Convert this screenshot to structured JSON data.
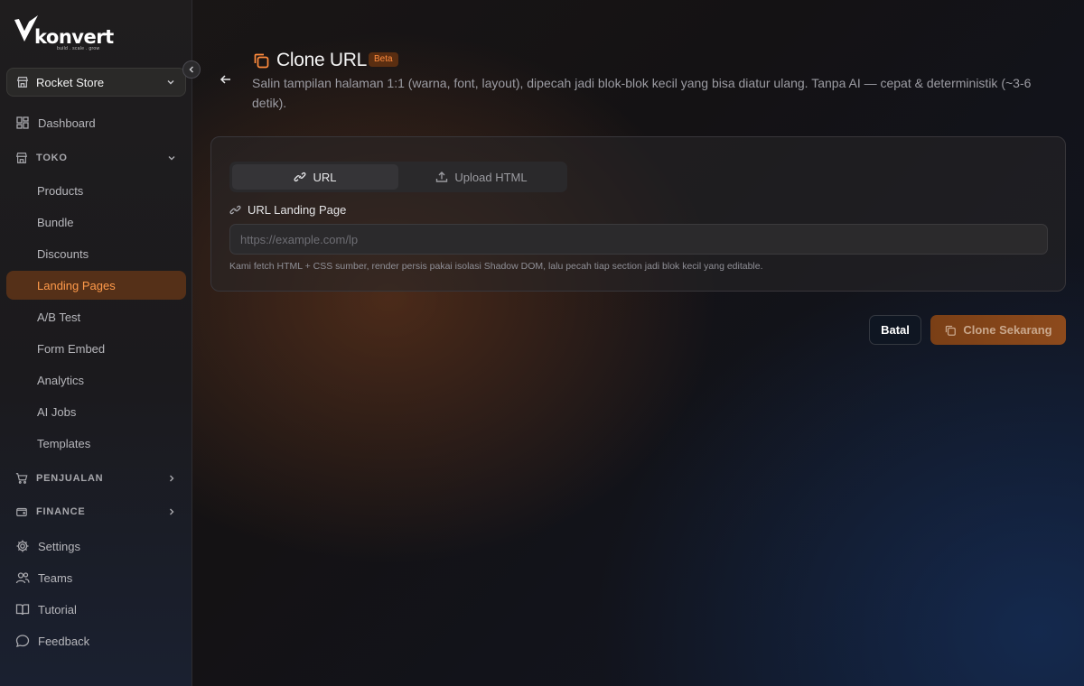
{
  "brand": {
    "name": "konvert",
    "tagline": "build . scale . grow"
  },
  "sidebar": {
    "store": {
      "name": "Rocket Store"
    },
    "items": {
      "dashboard": "Dashboard",
      "toko": "TOKO",
      "products": "Products",
      "bundle": "Bundle",
      "discounts": "Discounts",
      "landing_pages": "Landing Pages",
      "ab_test": "A/B Test",
      "form_embed": "Form Embed",
      "analytics": "Analytics",
      "ai_jobs": "AI Jobs",
      "templates": "Templates",
      "penjualan": "PENJUALAN",
      "finance": "FINANCE",
      "settings": "Settings",
      "teams": "Teams",
      "tutorial": "Tutorial",
      "feedback": "Feedback"
    },
    "active_item": "landing_pages"
  },
  "header": {
    "title": "Clone URL",
    "badge": "Beta",
    "description": "Salin tampilan halaman 1:1 (warna, font, layout), dipecah jadi blok-blok kecil yang bisa diatur ulang. Tanpa AI — cepat & deterministik (~3-6 detik)."
  },
  "form": {
    "tabs": [
      {
        "label": "URL",
        "active": true
      },
      {
        "label": "Upload HTML",
        "active": false
      }
    ],
    "url_label": "URL Landing Page",
    "url_value": "",
    "url_placeholder": "https://example.com/lp",
    "hint": "Kami fetch HTML + CSS sumber, render persis pakai isolasi Shadow DOM, lalu pecah tiap section jadi blok kecil yang editable."
  },
  "actions": {
    "cancel": "Batal",
    "clone": "Clone Sekarang"
  },
  "colors": {
    "accent": "#ff8b3d",
    "active_bg": "#753c16",
    "primary_btn": "#8d4a1c"
  }
}
